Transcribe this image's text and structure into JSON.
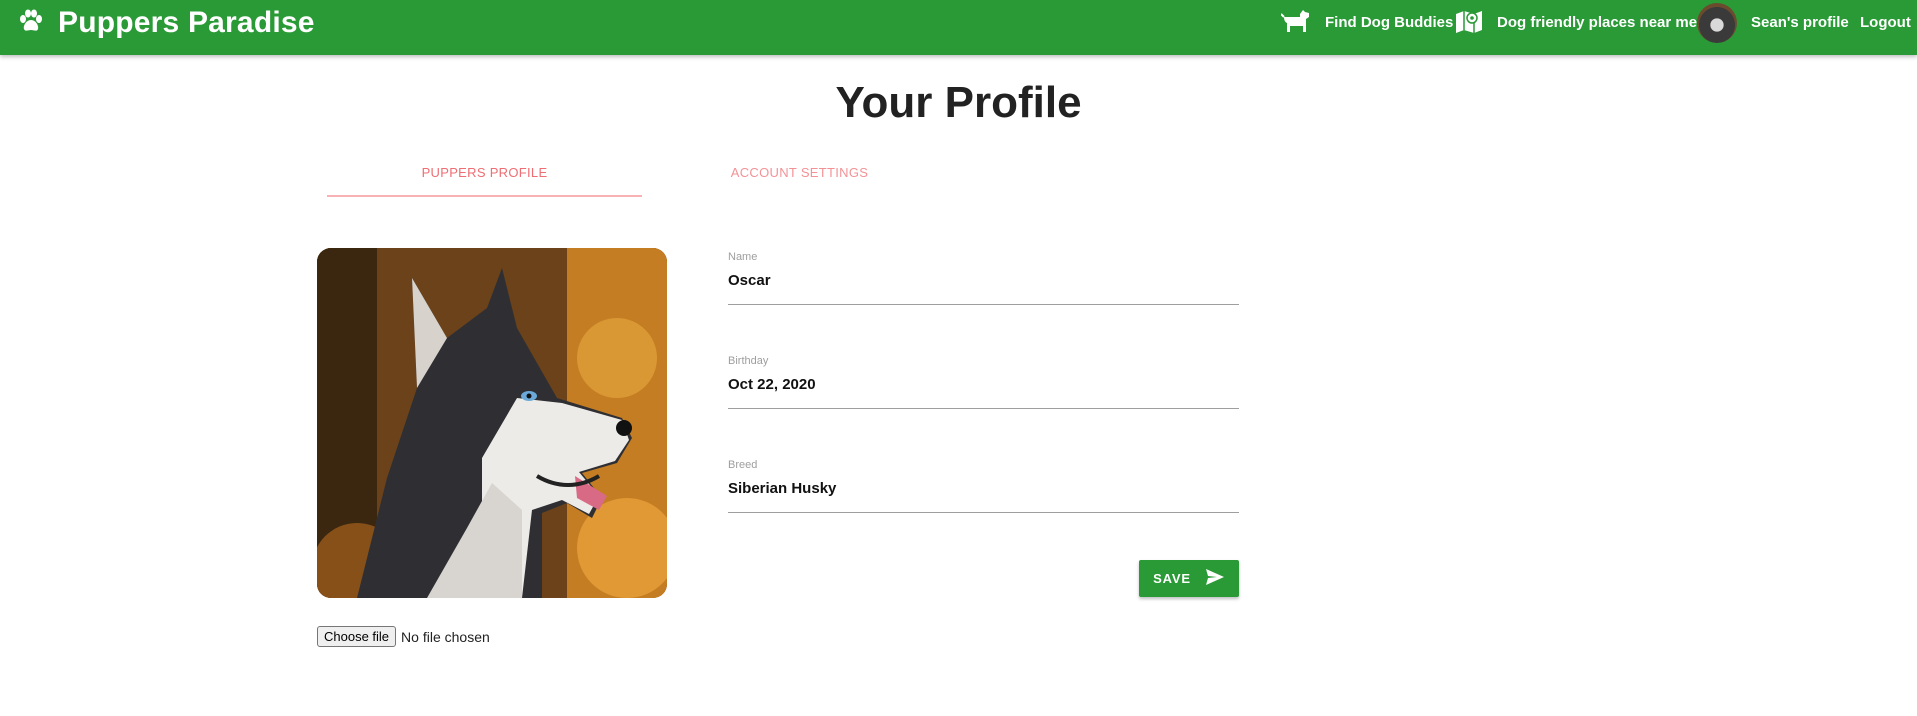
{
  "navbar": {
    "brand": "Puppers Paradise",
    "brand_icon": "paw-icon",
    "items": [
      {
        "label": "Find Dog Buddies",
        "icon": "dog-icon"
      },
      {
        "label": "Dog friendly places near me",
        "icon": "map-icon"
      },
      {
        "label": "Sean's profile",
        "icon": "avatar"
      },
      {
        "label": "Logout"
      }
    ]
  },
  "page": {
    "title": "Your Profile"
  },
  "tabs": [
    {
      "label": "Puppers Profile",
      "active": true
    },
    {
      "label": "Account Settings",
      "active": false
    }
  ],
  "form": {
    "name": {
      "label": "Name",
      "value": "Oscar"
    },
    "birthday": {
      "label": "Birthday",
      "value": "Oct 22, 2020"
    },
    "breed": {
      "label": "Breed",
      "value": "Siberian Husky"
    },
    "save_label": "SAVE",
    "file": {
      "button": "Choose file",
      "status": "No file chosen"
    }
  },
  "colors": {
    "primary": "#2a9a37",
    "tab_accent": "#ee6e73"
  }
}
